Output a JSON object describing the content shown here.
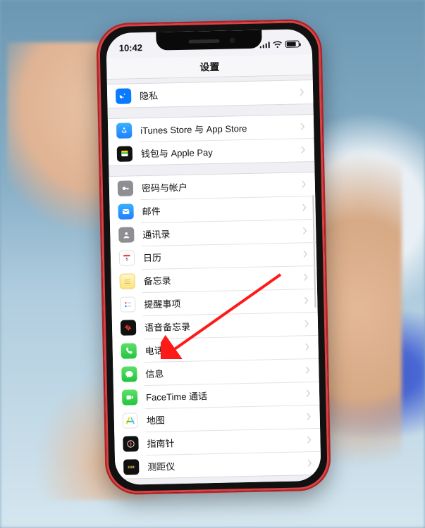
{
  "status": {
    "time": "10:42"
  },
  "navbar": {
    "title": "设置"
  },
  "groups": [
    {
      "rows": [
        {
          "name": "privacy",
          "label": "隐私"
        }
      ]
    },
    {
      "rows": [
        {
          "name": "itunes",
          "label": "iTunes Store 与 App Store"
        },
        {
          "name": "wallet",
          "label": "钱包与 Apple Pay"
        }
      ]
    },
    {
      "rows": [
        {
          "name": "passwords",
          "label": "密码与帐户"
        },
        {
          "name": "mail",
          "label": "邮件"
        },
        {
          "name": "contacts",
          "label": "通讯录"
        },
        {
          "name": "calendar",
          "label": "日历"
        },
        {
          "name": "notes",
          "label": "备忘录"
        },
        {
          "name": "reminders",
          "label": "提醒事项"
        },
        {
          "name": "voicememo",
          "label": "语音备忘录"
        },
        {
          "name": "phone",
          "label": "电话"
        },
        {
          "name": "messages",
          "label": "信息"
        },
        {
          "name": "facetime",
          "label": "FaceTime 通话"
        },
        {
          "name": "maps",
          "label": "地图"
        },
        {
          "name": "compass",
          "label": "指南针"
        },
        {
          "name": "measure",
          "label": "测距仪"
        }
      ]
    }
  ],
  "annotation": {
    "target_row": "phone"
  }
}
